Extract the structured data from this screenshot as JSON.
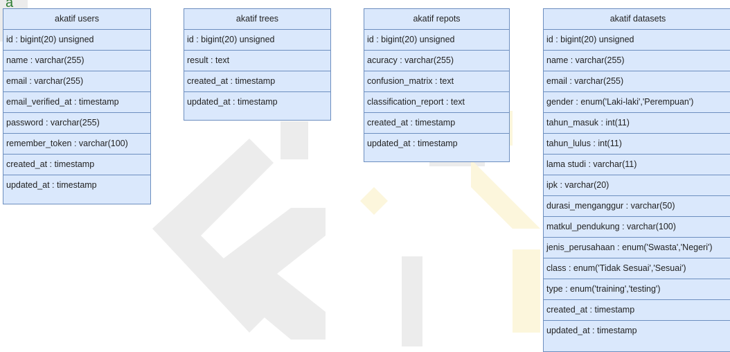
{
  "corner_mark": "a",
  "colors": {
    "entity_fill": "#dae8fc",
    "entity_border": "#6c8ebf",
    "watermark": "#e9e9e9",
    "watermark_gold": "#fbf3d2"
  },
  "entities": [
    {
      "title": "akatif users",
      "fields": [
        "id : bigint(20) unsigned",
        "name : varchar(255)",
        "email : varchar(255)",
        "email_verified_at : timestamp",
        "password : varchar(255)",
        "remember_token : varchar(100)",
        "created_at : timestamp",
        "updated_at : timestamp"
      ]
    },
    {
      "title": "akatif trees",
      "fields": [
        "id : bigint(20) unsigned",
        "result : text",
        "created_at : timestamp",
        "updated_at : timestamp"
      ]
    },
    {
      "title": "akatif repots",
      "fields": [
        "id : bigint(20) unsigned",
        "acuracy : varchar(255)",
        "confusion_matrix : text",
        "classification_report : text",
        "created_at : timestamp",
        "updated_at : timestamp"
      ]
    },
    {
      "title": "akatif datasets",
      "fields": [
        "id : bigint(20) unsigned",
        "name : varchar(255)",
        "email : varchar(255)",
        "gender : enum('Laki-laki','Perempuan')",
        "tahun_masuk : int(11)",
        "tahun_lulus : int(11)",
        "lama studi : varchar(11)",
        "ipk : varchar(20)",
        "durasi_menganggur : varchar(50)",
        "matkul_pendukung : varchar(100)",
        "jenis_perusahaan : enum('Swasta','Negeri')",
        "class : enum('Tidak Sesuai','Sesuai')",
        "type : enum('training','testing')",
        "created_at : timestamp",
        "updated_at : timestamp"
      ]
    }
  ]
}
